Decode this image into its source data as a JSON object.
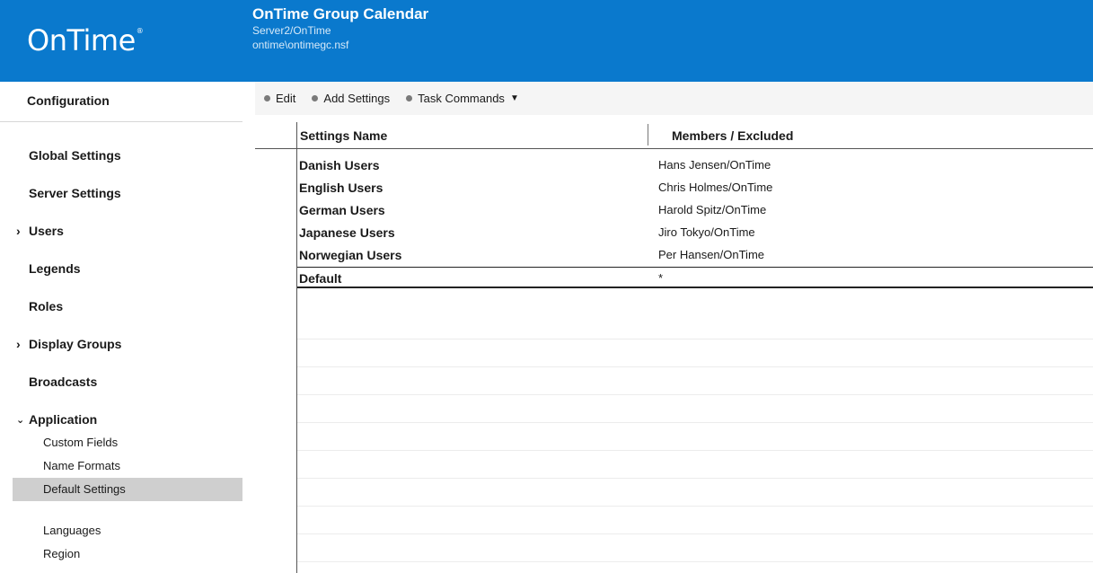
{
  "header": {
    "logo": "OnTime",
    "logo_mark": "®",
    "title": "OnTime Group Calendar",
    "server": "Server2/OnTime",
    "database": "ontime\\ontimegc.nsf"
  },
  "sidebar": {
    "heading": "Configuration",
    "items": [
      {
        "label": "Global Settings",
        "chevron": ""
      },
      {
        "label": "Server Settings",
        "chevron": ""
      },
      {
        "label": "Users",
        "chevron": ">"
      },
      {
        "label": "Legends",
        "chevron": ""
      },
      {
        "label": "Roles",
        "chevron": ""
      },
      {
        "label": "Display Groups",
        "chevron": ">"
      },
      {
        "label": "Broadcasts",
        "chevron": ""
      },
      {
        "label": "Application",
        "chevron": "v"
      }
    ],
    "app_subitems": [
      "Custom Fields",
      "Name Formats",
      "Default Settings"
    ],
    "extra_subitems": [
      "Languages",
      "Region"
    ]
  },
  "toolbar": {
    "edit": "Edit",
    "add_settings": "Add Settings",
    "task_commands": "Task Commands"
  },
  "view": {
    "columns": [
      "Settings Name",
      "Members / Excluded"
    ],
    "rows": [
      {
        "name": "Danish Users",
        "members": "Hans Jensen/OnTime"
      },
      {
        "name": "English Users",
        "members": "Chris Holmes/OnTime"
      },
      {
        "name": "German Users",
        "members": "Harold Spitz/OnTime"
      },
      {
        "name": "Japanese Users",
        "members": "Jiro Tokyo/OnTime"
      },
      {
        "name": "Norwegian Users",
        "members": "Per Hansen/OnTime"
      }
    ],
    "default_row": {
      "name": "Default",
      "members": "*"
    }
  },
  "colors": {
    "header_bg": "#0a79cd",
    "selected_bg": "#cfcfcf",
    "toolbar_bg": "#f5f5f5"
  }
}
